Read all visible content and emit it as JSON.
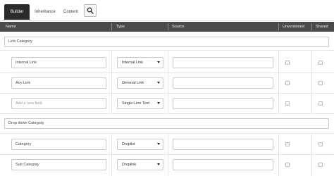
{
  "tabs": [
    {
      "label": "Builder",
      "active": true
    },
    {
      "label": "Inheritance",
      "active": false
    },
    {
      "label": "Content",
      "active": false
    }
  ],
  "search_icon": "search-icon",
  "columns": {
    "name": "Name",
    "type": "Type",
    "source": "Source",
    "unversioned": "Unversioned",
    "shared": "Shared"
  },
  "sections": [
    {
      "name": "Link Category",
      "fields": [
        {
          "name": "Internal Link",
          "placeholder": "",
          "type": "Internal Link",
          "source": "",
          "unversioned": false,
          "shared": false
        },
        {
          "name": "Any Link",
          "placeholder": "",
          "type": "General Link",
          "source": "",
          "unversioned": false,
          "shared": false
        },
        {
          "name": "",
          "placeholder": "Add a new field",
          "type": "Single-Line Text",
          "source": "",
          "unversioned": false,
          "shared": false
        }
      ]
    },
    {
      "name": "Drop down Category",
      "fields": [
        {
          "name": "Category",
          "placeholder": "",
          "type": "Droplist",
          "source": "",
          "unversioned": false,
          "shared": false
        },
        {
          "name": "Sub Category",
          "placeholder": "",
          "type": "Droplink",
          "source": "",
          "unversioned": false,
          "shared": false
        }
      ]
    }
  ],
  "colors": {
    "header_bg": "#4a4a4a",
    "active_tab_bg": "#2b2b2b",
    "border": "#c9c9c9"
  }
}
